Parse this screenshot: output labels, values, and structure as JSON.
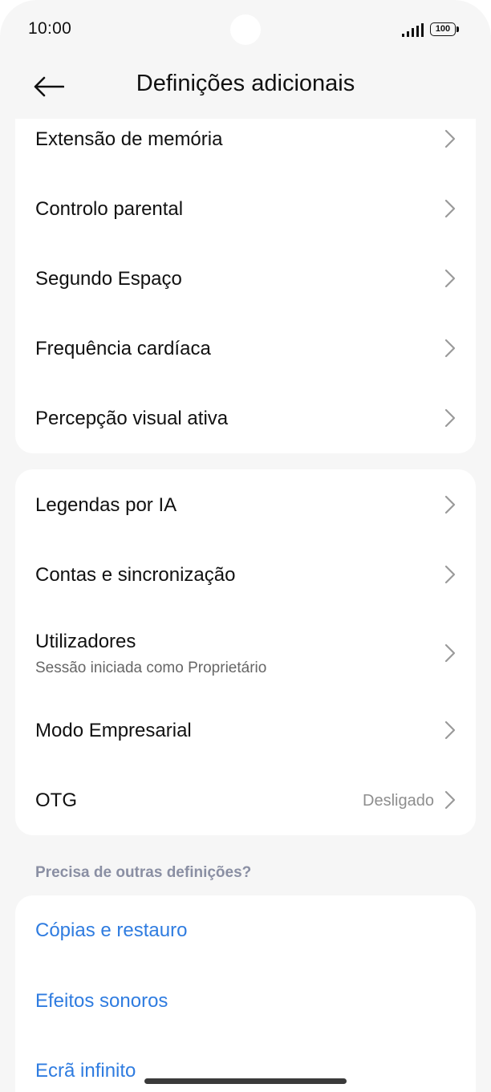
{
  "status_bar": {
    "time": "10:00",
    "battery": "100"
  },
  "header": {
    "title": "Definições adicionais"
  },
  "group1": [
    {
      "label": "Extensão de memória"
    },
    {
      "label": "Controlo parental"
    },
    {
      "label": "Segundo Espaço"
    },
    {
      "label": "Frequência cardíaca"
    },
    {
      "label": "Percepção visual ativa"
    }
  ],
  "group2": [
    {
      "label": "Legendas por IA"
    },
    {
      "label": "Contas e sincronização"
    },
    {
      "label": "Utilizadores",
      "subtitle": "Sessão iniciada como Proprietário"
    },
    {
      "label": "Modo Empresarial"
    },
    {
      "label": "OTG",
      "value": "Desligado"
    }
  ],
  "section": {
    "title": "Precisa de outras definições?"
  },
  "links": [
    {
      "label": "Cópias e restauro"
    },
    {
      "label": "Efeitos sonoros"
    },
    {
      "label": "Ecrã infinito"
    }
  ],
  "colors": {
    "link": "#2f7ce0",
    "section_title": "#8a8fa3",
    "background": "#f6f6f6"
  }
}
